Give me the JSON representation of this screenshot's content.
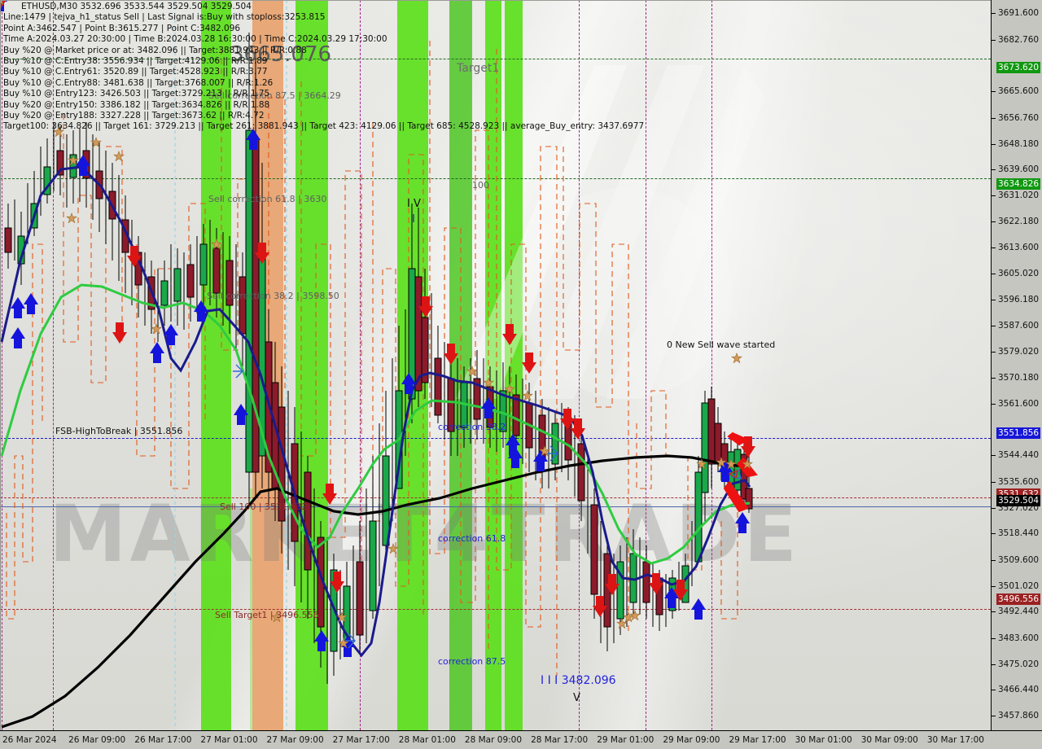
{
  "chart_data": {
    "type": "line",
    "title": "ETHUSD,M30  3532.696 3533.544 3529.504 3529.504",
    "symbol": "ETHUSD",
    "timeframe": "M30",
    "ohlc": {
      "open": 3532.696,
      "high": 3533.544,
      "low": 3529.504,
      "close": 3529.504
    },
    "ylabel": "",
    "xlabel": "",
    "ylim": [
      3453.0,
      3696.0
    ],
    "grid": false,
    "legend": "none",
    "y_ticks": [
      3691.6,
      3682.76,
      3673.62,
      3665.6,
      3656.76,
      3648.18,
      3639.6,
      3634.826,
      3631.02,
      3622.18,
      3613.6,
      3605.02,
      3596.18,
      3587.6,
      3579.02,
      3570.18,
      3561.6,
      3551.856,
      3544.44,
      3535.6,
      3531.632,
      3529.504,
      3527.02,
      3518.44,
      3509.6,
      3501.02,
      3496.556,
      3492.44,
      3483.6,
      3475.02,
      3466.44,
      3457.86
    ],
    "x_ticks": [
      "26 Mar 2024",
      "26 Mar 09:00",
      "26 Mar 17:00",
      "27 Mar 01:00",
      "27 Mar 09:00",
      "27 Mar 17:00",
      "28 Mar 01:00",
      "28 Mar 09:00",
      "28 Mar 17:00",
      "29 Mar 01:00",
      "29 Mar 09:00",
      "29 Mar 17:00",
      "30 Mar 01:00",
      "30 Mar 09:00",
      "30 Mar 17:00"
    ],
    "price_markers": [
      {
        "value": "3673.620",
        "color": "#119811",
        "style": "green"
      },
      {
        "value": "3634.826",
        "color": "#119811",
        "style": "green"
      },
      {
        "value": "3551.856",
        "color": "#1616d8",
        "style": "blue"
      },
      {
        "value": "3531.632",
        "color": "#9b2222",
        "style": "red"
      },
      {
        "value": "3529.504",
        "color": "#000000",
        "style": "black"
      },
      {
        "value": "3496.556",
        "color": "#9b2222",
        "style": "red"
      }
    ],
    "series": [
      {
        "name": "fast-ma-green",
        "color": "#2ecc40"
      },
      {
        "name": "slow-ma-blue",
        "color": "#1a1a8c"
      },
      {
        "name": "trend-ma-black",
        "color": "#000000"
      },
      {
        "name": "envelope-orange-dashed",
        "color": "#e05a1a"
      }
    ]
  },
  "header": {
    "line1": "ETHUSD,M30  3532.696 3533.544 3529.504 3529.504",
    "line2": "Line:1479 | tejva_h1_status  Sell | Last Signal is:Buy with stoploss:3253.815",
    "line3": "Point A:3462.547 | Point B:3615.277 | Point C:3482.096",
    "line4": "Time A:2024.03.27 20:30:00 | Time B:2024.03.28 16:30:00 | Time C:2024.03.29 17:30:00",
    "line5": "Buy %20 @ Market price or at: 3482.096  ||  Target:3881.943 || R/R:0.88",
    "line6": "Buy %10 @ C.Entry38: 3556.934 || Target:4129.06 || R/R:1.89",
    "line7": "Buy %10 @ C.Entry61: 3520.89 || Target:4528.923 || R/R:3.77",
    "line8": "Buy %10 @ C.Entry88: 3481.638 || Target:3768.007 || R/R:1.26",
    "line9": "Buy %10 @ Entry123: 3426.503 || Target:3729.213 || R/R:1.75",
    "line10": "Buy %20 @ Entry150: 3386.182 || Target:3634.826 || R/R:1.88",
    "line11": "Buy %20 @ Entry188: 3327.228 || Target:3673.62 || R/R:4.72",
    "line12": "Target100: 3634.826 || Target 161: 3729.213 || Target 261: 3881.943 || Target 423: 4129.06 || Target 685: 4528.923 || average_Buy_entry: 3437.6977"
  },
  "annotations": {
    "big_price": "3665.076",
    "target1": "Target1",
    "target100": "100",
    "sell_corr_875": "Sell correction 87.5 | 3664.29",
    "sell_corr_618": "Sell correction 61.8 | 3630",
    "sell_corr_382": "Sell correction 38.2 | 3598.50",
    "fsb_high": "FSB-HighToBreak | 3551.856",
    "sell100": "Sell 100 | 3531.632",
    "sell_target1": "Sell Target1 | 3496.556",
    "correction_382": "correction 38.2",
    "correction_618": "correction 61.8",
    "correction_875": "correction 87.5",
    "new_sell_wave": "0 New Sell wave started",
    "wave_label_IV": "I V",
    "wave_price": "I I I 3482.096",
    "wave_v": "V",
    "watermark": "MARKET4TRADE"
  },
  "colors": {
    "band_green": "#5ce01c",
    "band_orange": "#e8a878",
    "bg": "#e0e0dc",
    "axis_bg": "#c6c6c1",
    "ma_green": "#2ecc40",
    "ma_blue": "#1a1a8c",
    "ma_black": "#000000",
    "envelope": "#e05a1a",
    "up_candle": "#1aa84a",
    "down_candle": "#8b1b2b"
  }
}
